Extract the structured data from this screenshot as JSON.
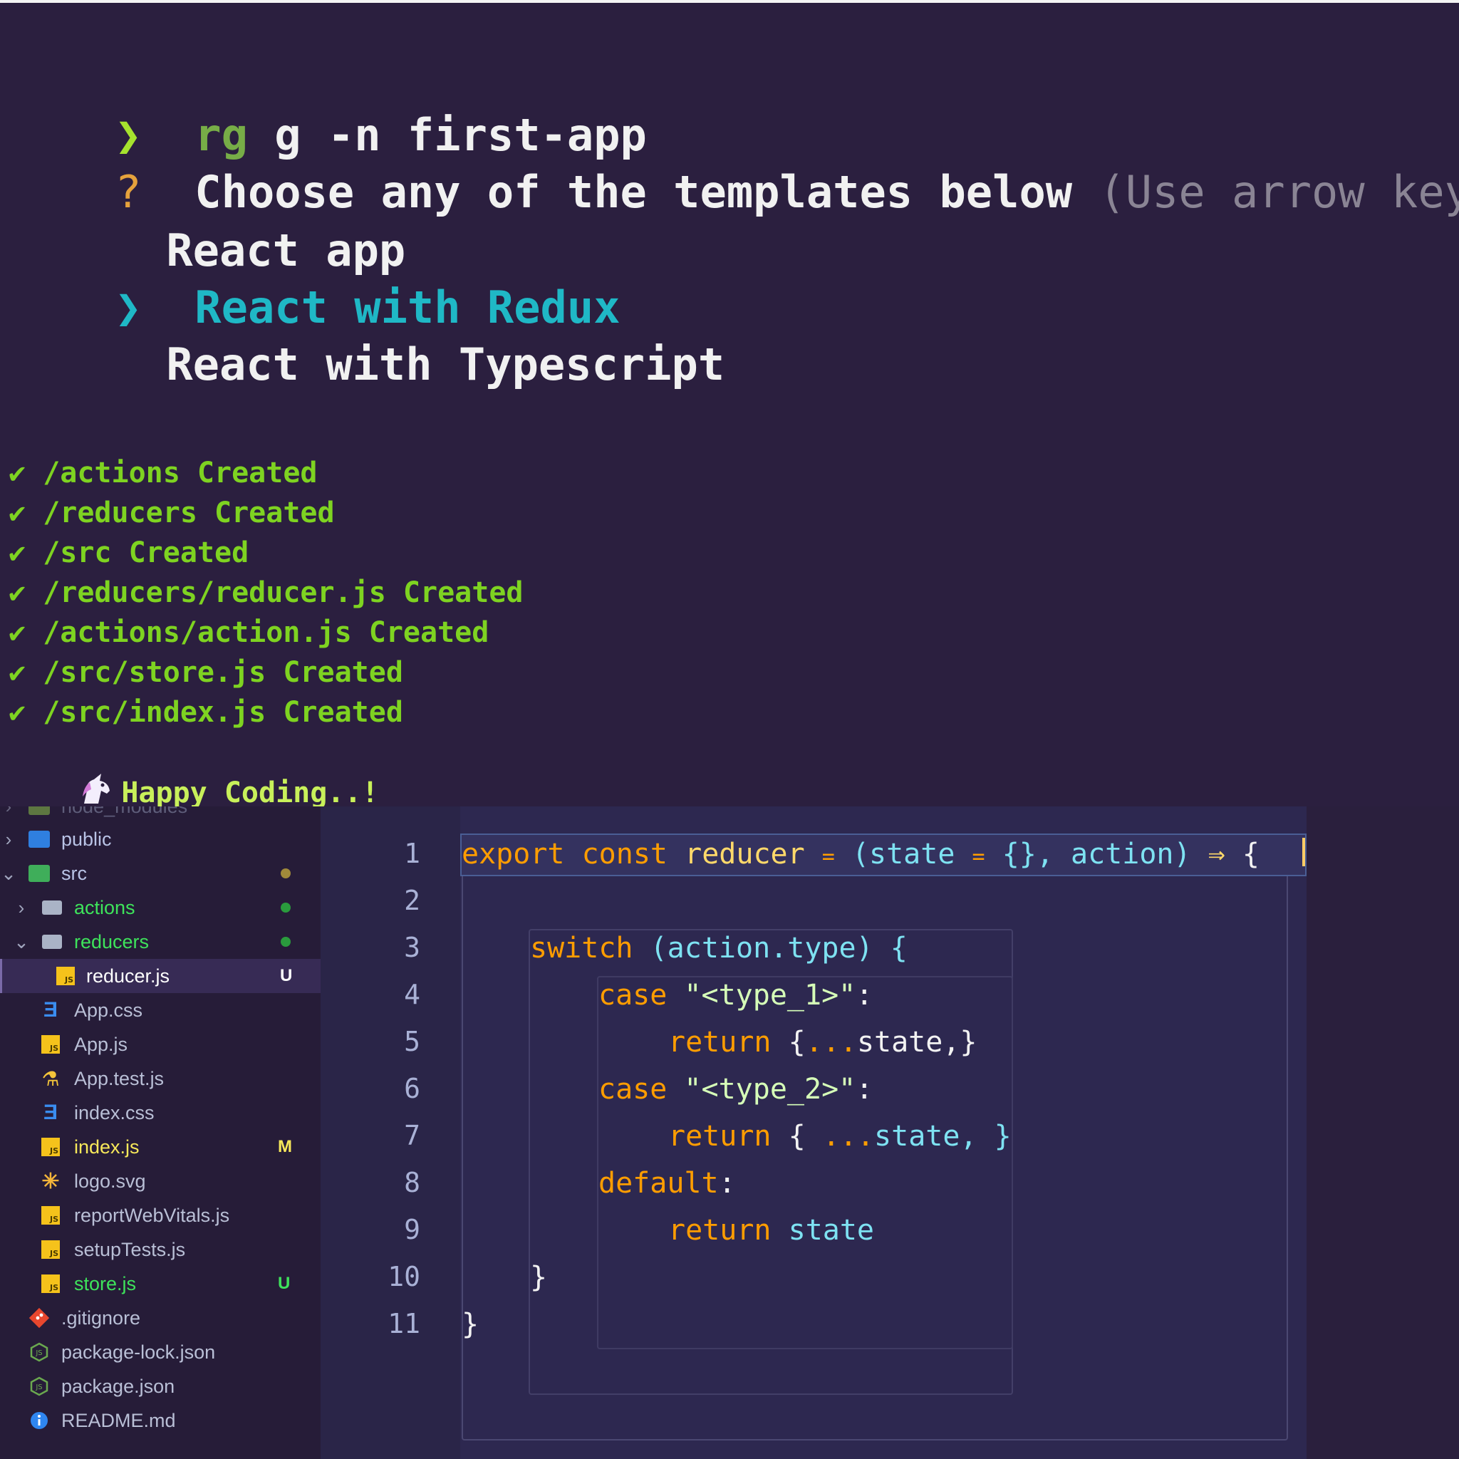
{
  "terminal": {
    "command": {
      "prompt": "❯",
      "cmd": "rg",
      "args": " g -n first-app"
    },
    "question": {
      "mark": "?",
      "text": "Choose any of the templates below",
      "hint": " (Use arrow keys)"
    },
    "options": [
      {
        "label": "React app",
        "selected": false
      },
      {
        "label": "React with Redux",
        "selected": true
      },
      {
        "label": "React with Typescript",
        "selected": false
      }
    ],
    "selected_pointer": "❯",
    "check": "✔",
    "created": [
      "/actions Created",
      "/reducers Created",
      "/src Created",
      "/reducers/reducer.js Created",
      "/actions/action.js Created",
      "/src/store.js Created",
      "/src/index.js Created"
    ],
    "farewell": "Happy Coding..!"
  },
  "explorer": {
    "items": [
      {
        "name": "public",
        "status": ""
      },
      {
        "name": "src",
        "status": "dot"
      },
      {
        "name": "actions",
        "status": "dot"
      },
      {
        "name": "reducers",
        "status": "dot"
      },
      {
        "name": "reducer.js",
        "status": "U"
      },
      {
        "name": "App.css",
        "status": ""
      },
      {
        "name": "App.js",
        "status": ""
      },
      {
        "name": "App.test.js",
        "status": ""
      },
      {
        "name": "index.css",
        "status": ""
      },
      {
        "name": "index.js",
        "status": "M"
      },
      {
        "name": "logo.svg",
        "status": ""
      },
      {
        "name": "reportWebVitals.js",
        "status": ""
      },
      {
        "name": "setupTests.js",
        "status": ""
      },
      {
        "name": "store.js",
        "status": "U"
      },
      {
        "name": ".gitignore",
        "status": ""
      },
      {
        "name": "package-lock.json",
        "status": ""
      },
      {
        "name": "package.json",
        "status": ""
      },
      {
        "name": "README.md",
        "status": ""
      }
    ]
  },
  "editor": {
    "line_numbers": [
      "1",
      "2",
      "3",
      "4",
      "5",
      "6",
      "7",
      "8",
      "9",
      "10",
      "11"
    ],
    "code": {
      "l1": {
        "export": "export",
        "const": "const",
        "name": "reducer",
        "eq": "=",
        "rest1": "(state",
        "eq2": "=",
        "rest2": "{}, action)",
        "arrow": "⇒",
        "brace": "{"
      },
      "l3": {
        "kw": "switch",
        "expr": "(action.type) {"
      },
      "l4": {
        "kw": "case",
        "str": "\"<type_1>\"",
        "colon": ":"
      },
      "l5": {
        "kw": "return",
        "obj1": "{",
        "spread": "...",
        "obj2": "state,}"
      },
      "l6": {
        "kw": "case",
        "str": "\"<type_2>\"",
        "colon": ":"
      },
      "l7": {
        "kw": "return",
        "obj1": "{",
        "spread": "...",
        "obj2": "state, }"
      },
      "l8": {
        "kw": "default",
        "colon": ":"
      },
      "l9": {
        "kw": "return",
        "ident": "state"
      },
      "l10": {
        "brace": "}"
      },
      "l11": {
        "brace": "}"
      }
    }
  },
  "colors": {
    "terminal_bg": "#2b1f3f",
    "explorer_bg": "#261c38",
    "editor_bg": "#2d2850",
    "accent_green": "#3ee35b",
    "accent_cyan": "#1fb8c6",
    "keyword_orange": "#ff9d00"
  }
}
